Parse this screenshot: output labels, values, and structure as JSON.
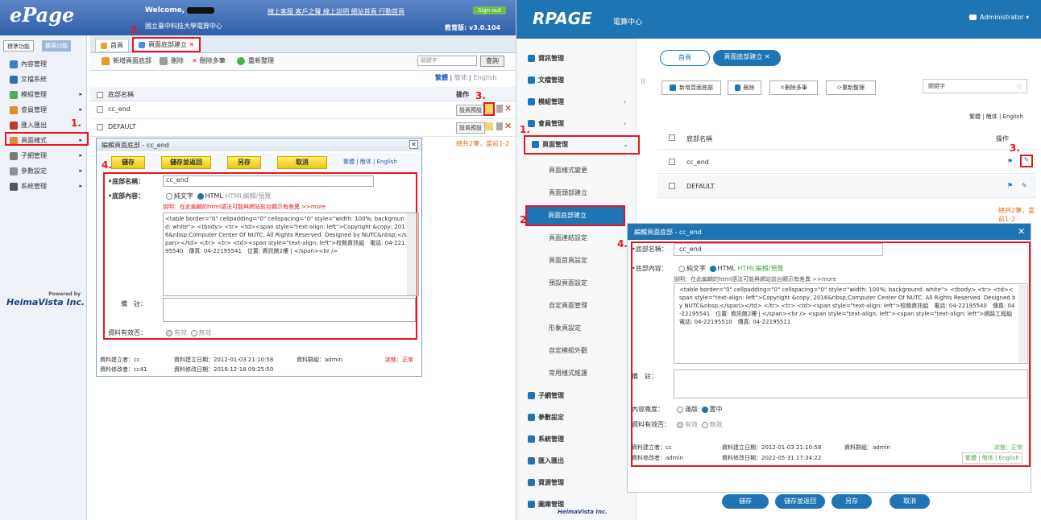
{
  "left": {
    "logo": "ePage",
    "welcome": "Welcome,",
    "org": "國立臺中科技大學電算中心",
    "top_links": "線上客服  客戶之聲  線上說明  網站首頁  行動首頁",
    "signout": "Sign out",
    "version": "教育版: v3.0.104",
    "side_tabs": [
      "標準功能",
      "擴展功能"
    ],
    "menu": [
      {
        "label": "內容管理",
        "arrow": false,
        "color": "#3d7cc9"
      },
      {
        "label": "文檔系統",
        "arrow": false,
        "color": "#2f6fb5"
      },
      {
        "label": "模組管理",
        "arrow": true,
        "color": "#4caf50"
      },
      {
        "label": "會員管理",
        "arrow": true,
        "color": "#e08a2c"
      },
      {
        "label": "匯入匯出",
        "arrow": false,
        "color": "#c0392b"
      },
      {
        "label": "頁面樣式",
        "arrow": true,
        "color": "#e08a2c"
      },
      {
        "label": "子網管理",
        "arrow": true,
        "color": "#7a7a7a"
      },
      {
        "label": "參數設定",
        "arrow": true,
        "color": "#8e8e8e"
      },
      {
        "label": "系統管理",
        "arrow": true,
        "color": "#555555"
      }
    ],
    "powered_by": "Powered by",
    "heimavista": "HeimaVista Inc.",
    "tabs": [
      "首頁",
      "頁面底部建立"
    ],
    "toolbar": [
      "新增頁面底部",
      "刪除",
      "刪除多筆",
      "重新整理"
    ],
    "search_placeholder": "關鍵字",
    "search_button": "查詢",
    "lang": {
      "a": "繁體",
      "b": "簡体",
      "c": "English"
    },
    "table_header": {
      "name": "底部名稱",
      "op": "操作"
    },
    "rows": [
      {
        "name": "cc_end",
        "btn": "設爲預設"
      },
      {
        "name": "DEFAULT",
        "btn": "設爲預設"
      }
    ],
    "count": "總共2筆，當前1-2",
    "dialog": {
      "title": "編輯頁面底部 - cc_end",
      "buttons": [
        "儲存",
        "儲存並返回",
        "另存",
        "取消"
      ],
      "lang": "繁體 | 簡体 | English",
      "label_name": "•底部名稱：",
      "name_value": "cc_end",
      "label_content": "•底部內容：",
      "mode_plain": "純文字",
      "mode_html": "HTML",
      "mode_link": "HTML編輯/預覽",
      "note_red": "說明：在此編輯的html語法可能與網站前台顯示有差異 >>more",
      "code": "<table border=\"0\" cellpadding=\"0\" cellspacing=\"0\" style=\"width: 100%; background: white\"> <tbody> <tr> <td><span style=\"text-align: left\">Copyright &copy; 2016&nbsp;Computer Center Of NUTC. All Rights Reserved. Designed by NUTC&nbsp;</span></td> </tr> <tr> <td><span style=\"text-align: left\">校務資訊組　電話: 04-22195540　傳真: 04-22195541　位置: 資訊館2樓 | </span><br />",
      "label_remark": "備　註：",
      "label_valid": "資料有效否：",
      "valid_yes": "有效",
      "valid_no": "無效",
      "creator": "資料建立者：cc",
      "created": "資料建立日期：2012-01-03 21:10:58",
      "group": "資料群組：admin",
      "status": "狀態：正常",
      "modifier": "資料修改者：cc41",
      "modified": "資料修改日期：2018-12-18 09:25:50"
    },
    "steps": [
      "1.",
      "2.",
      "3.",
      "4."
    ]
  },
  "right": {
    "logo": "RPAGE",
    "logo_sub": "電算中心",
    "user": "Administrator",
    "menu": [
      {
        "label": "資訊管理",
        "arrow": false
      },
      {
        "label": "文檔管理",
        "arrow": false
      },
      {
        "label": "模組管理",
        "arrow": true
      },
      {
        "label": "會員管理",
        "arrow": true
      },
      {
        "label": "頁面管理",
        "arrow": true
      }
    ],
    "submenu": [
      "頁面樣式變更",
      "頁面頭部建立",
      "頁面底部建立",
      "頁面連結設定",
      "頁面首頁設定",
      "預設頁面設定",
      "自定頁面管理",
      "形象頁設定",
      "自定模組外觀",
      "常用樣式維護"
    ],
    "menu2": [
      "子網管理",
      "參數設定",
      "系統管理",
      "匯入匯出",
      "資源管理",
      "圖庫管理"
    ],
    "powered": "HeimaVista Inc.",
    "pills": [
      "首頁",
      "頁面底部建立"
    ],
    "toolbar": [
      "新增頁面底部",
      "刪除",
      "刪除多筆",
      "重新整理"
    ],
    "search_placeholder": "關鍵字",
    "lang": "繁體 | 簡体 | English",
    "table_header": {
      "name": "底部名稱",
      "op": "操作"
    },
    "rows": [
      "cc_end",
      "DEFAULT"
    ],
    "count": "總共2筆，當前1-2",
    "dialog": {
      "title": "編輯頁面底部 - cc_end",
      "label_name": "•底部名稱：",
      "name_value": "cc_end",
      "label_content": "•底部內容：",
      "mode_plain": "純文字",
      "mode_html": "HTML",
      "mode_link": "HTML編輯/預覽",
      "note": "說明：在此編輯的html語法可能與網站前台顯示有差異 >>more",
      "code": "<table border=\"0\" cellpadding=\"0\" cellspacing=\"0\" style=\"width: 100%; background: white\"> <tbody> <tr> <td><span style=\"text-align: left\">Copyright &copy; 2016&nbsp;Computer Center Of NUTC. All Rights Reserved. Designed by NUTC&nbsp;</span></td> </tr> <tr> <td><span style=\"text-align: left\">校務資訊組　電話: 04-22195540　傳真: 04-22195541　位置: 資訊館2樓 | </span><br /> <span style=\"text-align: left\"><span style=\"text-align: left\">網路工程組　電話: 04-22195510　傳真: 04-22195511",
      "label_remark": "備　註：",
      "label_width": "內容寬度：",
      "width_full": "滿版",
      "width_center": "置中",
      "label_valid": "資料有效否：",
      "valid_yes": "有效",
      "valid_no": "無效",
      "creator": "資料建立者：cc",
      "created": "資料建立日期：2012-01-03 21:10:58",
      "group": "資料群組：admin",
      "status": "狀態：正常",
      "modifier": "資料修改者：admin",
      "modified": "資料修改日期：2022-05-31 17:34:22",
      "lang": "繁體 | 簡体 | English",
      "buttons": [
        "儲存",
        "儲存並返回",
        "另存",
        "取消"
      ]
    },
    "steps": [
      "1.",
      "2.",
      "3.",
      "4."
    ]
  },
  "colors": {
    "left_header": "#2e5fa8",
    "right_header": "#1f74b3",
    "highlight": "#e8151c",
    "yellow_button": "#f2d62e"
  }
}
